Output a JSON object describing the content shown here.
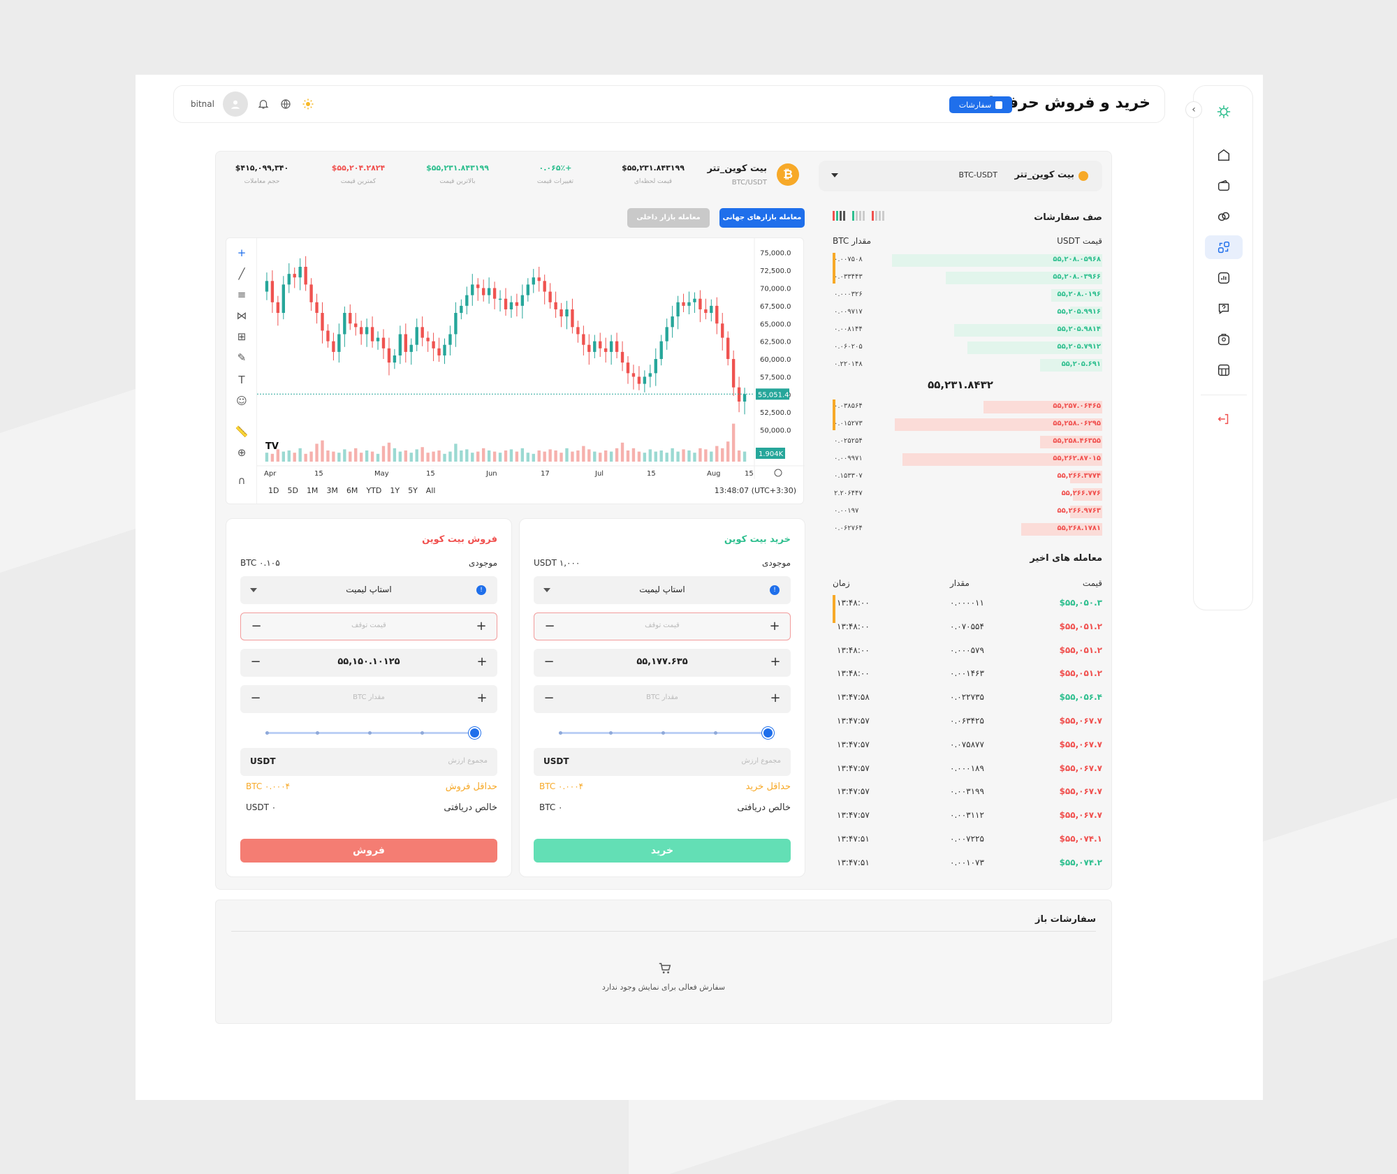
{
  "header": {
    "title": "خرید و فروش حرفه ای",
    "orders_button": "سفارشات",
    "username": "bitnal"
  },
  "pair_select": {
    "label": "بیت کوین_تتر",
    "symbol": "BTC-USDT"
  },
  "stats": {
    "coin_symbol": "₿",
    "pair_name": "بیت کوین_تتر",
    "pair_sub": "BTC/USDT",
    "items": [
      {
        "value": "$۵۵,۲۳۱.۸۴۳۱۹۹",
        "label": "قیمت لحظه‌ای",
        "color": "#111111"
      },
      {
        "value": "+۰.۰۶۵٪",
        "label": "تغییرات قیمت",
        "color": "#2fbf8f"
      },
      {
        "value": "$۵۵,۲۳۱.۸۴۳۱۹۹",
        "label": "بالاترین قیمت",
        "color": "#2fbf8f"
      },
      {
        "value": "$۵۵,۲۰۴.۲۸۲۴",
        "label": "کمترین قیمت",
        "color": "#f0514f"
      },
      {
        "value": "$۴۱۵,۰۹۹,۳۴۰",
        "label": "حجم معاملات",
        "color": "#111111"
      }
    ]
  },
  "market_tabs": {
    "global": "معامله بازارهای جهانی",
    "local": "معامله بازار داخلی"
  },
  "chart_data": {
    "type": "candlestick",
    "x_ticks": [
      "Apr",
      "15",
      "May",
      "15",
      "Jun",
      "17",
      "Jul",
      "15",
      "Aug",
      "15"
    ],
    "y_ticks": [
      "75,000.0",
      "72,500.0",
      "70,000.0",
      "67,500.0",
      "65,000.0",
      "62,500.0",
      "60,000.0",
      "57,500.0",
      "55,000.0",
      "52,500.0",
      "50,000.0"
    ],
    "ylim": [
      47500,
      76250
    ],
    "current_price_label": "55,051.4",
    "volume_label": "1.904K",
    "closes": [
      69500,
      71000,
      68000,
      66500,
      70500,
      72000,
      71500,
      73000,
      70500,
      68000,
      66500,
      64000,
      62500,
      61000,
      63500,
      66500,
      65000,
      64500,
      63500,
      64500,
      62500,
      63000,
      61500,
      59500,
      60500,
      63500,
      61000,
      62000,
      64500,
      63000,
      62500,
      61500,
      60500,
      62000,
      63500,
      66500,
      67500,
      69000,
      70500,
      70000,
      69000,
      70000,
      68500,
      68500,
      67000,
      68000,
      67500,
      69000,
      70500,
      71500,
      71000,
      69500,
      68000,
      67000,
      66000,
      67000,
      64500,
      63500,
      62000,
      61000,
      62500,
      61500,
      61000,
      62500,
      61000,
      59500,
      58000,
      57500,
      56500,
      57500,
      58000,
      60000,
      62500,
      64500,
      66000,
      68000,
      67500,
      68000,
      68500,
      67000,
      66500,
      67500,
      65000,
      63000,
      60000,
      56000,
      54000,
      55051
    ],
    "volume": [
      30,
      40,
      35,
      55,
      45,
      50,
      40,
      60,
      35,
      45,
      80,
      95,
      50,
      45,
      40,
      55,
      45,
      60,
      40,
      50,
      45,
      35,
      70,
      85,
      60,
      45,
      50,
      40,
      55,
      65,
      40,
      45,
      50,
      35,
      45,
      80,
      50,
      55,
      40,
      45,
      60,
      50,
      45,
      40,
      50,
      55,
      45,
      60,
      40,
      35,
      50,
      45,
      55,
      50,
      40,
      60,
      45,
      50,
      70,
      55,
      45,
      40,
      50,
      45,
      60,
      85,
      50,
      60,
      45,
      40,
      55,
      45,
      50,
      40,
      60,
      45,
      55,
      50,
      40,
      60,
      55,
      45,
      70,
      60,
      90,
      170,
      50,
      45
    ],
    "range_buttons": [
      "1D",
      "5D",
      "1M",
      "3M",
      "6M",
      "YTD",
      "1Y",
      "5Y",
      "All"
    ],
    "clock": "13:48:07 (UTC+3:30)",
    "tv_logo": "TV"
  },
  "buy_form": {
    "title": "خرید بیت کوین",
    "balance_label": "موجودی",
    "balance_value": "USDT ۱,۰۰۰",
    "order_type": "استاپ لیمیت",
    "stop_price_placeholder": "قیمت توقف",
    "price_value": "۵۵,۱۷۷.۶۳۵",
    "amount_placeholder": "مقدار BTC",
    "total_placeholder": "مجموع ارزش",
    "total_unit": "USDT",
    "min_label": "حداقل خرید",
    "min_value": "BTC ۰.۰۰۰۴",
    "net_label": "خالص دریافتی",
    "net_value": "BTC ۰",
    "submit": "خرید",
    "slider_fraction": 1.0
  },
  "sell_form": {
    "title": "فروش بیت کوین",
    "balance_label": "موجودی",
    "balance_value": "BTC ۰.۱۰۵",
    "order_type": "استاپ لیمیت",
    "stop_price_placeholder": "قیمت توقف",
    "price_value": "۵۵,۱۵۰.۱۰۱۲۵",
    "amount_placeholder": "مقدار BTC",
    "total_placeholder": "مجموع ارزش",
    "total_unit": "USDT",
    "min_label": "حداقل فروش",
    "min_value": "BTC ۰.۰۰۰۴",
    "net_label": "خالص دریافتی",
    "net_value": "USDT ۰",
    "submit": "فروش",
    "slider_fraction": 1.0
  },
  "order_book": {
    "title": "صف سفارشات",
    "price_header": "قیمت USDT",
    "amount_header": "مقدار BTC",
    "bids": [
      {
        "price": "۵۵,۲۰۸.۰۵۹۶۸",
        "qty": "۰.۰۰۷۵۰۸",
        "depth": 0.78
      },
      {
        "price": "۵۵,۲۰۸.۰۳۹۶۶",
        "qty": "۰.۰۳۳۴۴۳",
        "depth": 0.58
      },
      {
        "price": "۵۵,۲۰۸.۰۱۹۶",
        "qty": "۰.۰۰۰۳۲۶",
        "depth": 0.19
      },
      {
        "price": "۵۵,۲۰۵.۹۹۱۶",
        "qty": "۰.۰۰۹۷۱۷",
        "depth": 0.12
      },
      {
        "price": "۵۵,۲۰۵.۹۸۱۴",
        "qty": "۰.۰۰۸۱۴۴",
        "depth": 0.55
      },
      {
        "price": "۵۵,۲۰۵.۷۹۱۲",
        "qty": "۰.۰۶۰۲۰۵",
        "depth": 0.5
      },
      {
        "price": "۵۵,۲۰۵.۶۹۱",
        "qty": "۰.۲۲۰۱۴۸",
        "depth": 0.23
      }
    ],
    "mid_price": "۵۵,۲۳۱.۸۴۳۲",
    "asks": [
      {
        "price": "۵۵,۲۵۷.۰۶۴۶۵",
        "qty": "۰.۰۳۸۵۶۴",
        "depth": 0.44
      },
      {
        "price": "۵۵,۲۵۸.۰۶۲۹۵",
        "qty": "۰.۰۱۵۲۷۳",
        "depth": 0.77
      },
      {
        "price": "۵۵,۲۵۸.۴۶۳۵۵",
        "qty": "۰.۰۲۵۲۵۴",
        "depth": 0.23
      },
      {
        "price": "۵۵,۲۶۲.۸۷۰۱۵",
        "qty": "۰.۰۰۹۹۷۱",
        "depth": 0.74
      },
      {
        "price": "۵۵,۲۶۶.۳۷۷۴",
        "qty": "۰.۱۵۳۳۰۷",
        "depth": 0.12
      },
      {
        "price": "۵۵,۲۶۶.۷۷۶",
        "qty": "۲.۲۰۶۴۴۷",
        "depth": 0.11
      },
      {
        "price": "۵۵,۲۶۶.۹۷۶۳",
        "qty": "۰.۰۰۱۹۷",
        "depth": 0.12
      },
      {
        "price": "۵۵,۲۶۸.۱۷۸۱",
        "qty": "۰.۰۶۲۷۶۴",
        "depth": 0.3
      }
    ]
  },
  "trades": {
    "title": "معامله های اخیر",
    "price_header": "قیمت",
    "amount_header": "مقدار",
    "time_header": "زمان",
    "rows": [
      {
        "price": "$۵۵,۰۵۰.۳",
        "amount": "۰.۰۰۰۰۱۱",
        "time": "۱۳:۴۸:۰۰",
        "side": "buy"
      },
      {
        "price": "$۵۵,۰۵۱.۲",
        "amount": "۰.۰۷۰۵۵۴",
        "time": "۱۳:۴۸:۰۰",
        "side": "sell"
      },
      {
        "price": "$۵۵,۰۵۱.۲",
        "amount": "۰.۰۰۰۵۷۹",
        "time": "۱۳:۴۸:۰۰",
        "side": "sell"
      },
      {
        "price": "$۵۵,۰۵۱.۲",
        "amount": "۰.۰۰۱۴۶۳",
        "time": "۱۳:۴۸:۰۰",
        "side": "sell"
      },
      {
        "price": "$۵۵,۰۵۶.۴",
        "amount": "۰.۰۲۲۷۳۵",
        "time": "۱۳:۴۷:۵۸",
        "side": "buy"
      },
      {
        "price": "$۵۵,۰۶۷.۷",
        "amount": "۰.۰۶۳۴۲۵",
        "time": "۱۳:۴۷:۵۷",
        "side": "sell"
      },
      {
        "price": "$۵۵,۰۶۷.۷",
        "amount": "۰.۰۷۵۸۷۷",
        "time": "۱۳:۴۷:۵۷",
        "side": "sell"
      },
      {
        "price": "$۵۵,۰۶۷.۷",
        "amount": "۰.۰۰۰۱۸۹",
        "time": "۱۳:۴۷:۵۷",
        "side": "sell"
      },
      {
        "price": "$۵۵,۰۶۷.۷",
        "amount": "۰.۰۰۳۱۹۹",
        "time": "۱۳:۴۷:۵۷",
        "side": "sell"
      },
      {
        "price": "$۵۵,۰۶۷.۷",
        "amount": "۰.۰۰۳۱۱۲",
        "time": "۱۳:۴۷:۵۷",
        "side": "sell"
      },
      {
        "price": "$۵۵,۰۷۴.۱",
        "amount": "۰.۰۰۷۲۲۵",
        "time": "۱۳:۴۷:۵۱",
        "side": "sell"
      },
      {
        "price": "$۵۵,۰۷۴.۲",
        "amount": "۰.۰۰۱۰۷۳",
        "time": "۱۳:۴۷:۵۱",
        "side": "buy"
      }
    ]
  },
  "open_orders": {
    "title": "سفارشات باز",
    "empty_text": "سفارش فعالی برای نمایش وجود ندارد"
  },
  "colors": {
    "buy": "#2fbf8f",
    "sell": "#f0514f",
    "accent": "#1f6feb",
    "bid_bar": "#e2f5ec",
    "ask_bar": "#fbdcd8",
    "buy_button": "#63dfb5",
    "sell_button": "#f47d73"
  }
}
